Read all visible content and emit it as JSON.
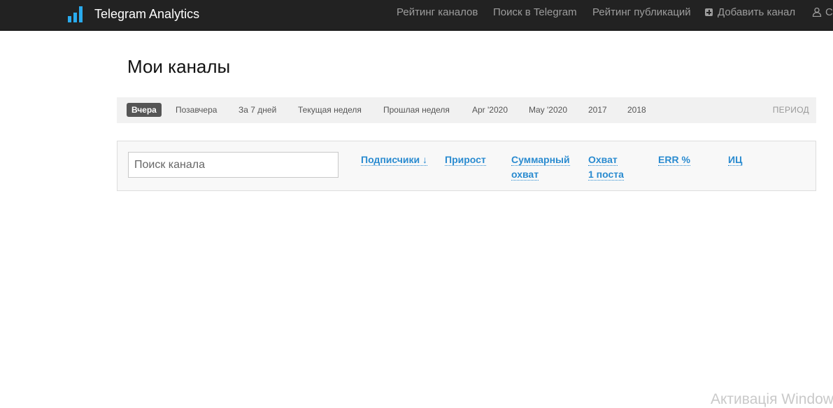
{
  "navbar": {
    "brand": "Telegram Analytics",
    "items": [
      {
        "label": "Рейтинг каналов"
      },
      {
        "label": "Поиск в Telegram"
      },
      {
        "label": "Рейтинг публикаций"
      },
      {
        "label": "Добавить канал",
        "icon": "plus-square-icon"
      },
      {
        "label": "С",
        "icon": "user-icon"
      }
    ]
  },
  "page": {
    "title": "Мои каналы"
  },
  "periods": {
    "items": [
      "Вчера",
      "Позавчера",
      "За 7 дней",
      "Текущая неделя",
      "Прошлая неделя",
      "Apr '2020",
      "May '2020",
      "2017",
      "2018"
    ],
    "active_index": 0,
    "label": "ПЕРИОД"
  },
  "search": {
    "placeholder": "Поиск канала",
    "value": ""
  },
  "columns": {
    "subscribers": "Подписчики ↓",
    "growth": "Прирост",
    "total_reach_1": "Суммарный",
    "total_reach_2": "охват",
    "post_reach_1": "Охват",
    "post_reach_2": "1 поста",
    "err": "ERR %",
    "ic": "ИЦ"
  },
  "watermark": "Активація Windows",
  "colors": {
    "navbar_bg": "#222222",
    "link": "#2a8bd0",
    "active_period_bg": "#555555",
    "logo": "#2aabee"
  }
}
